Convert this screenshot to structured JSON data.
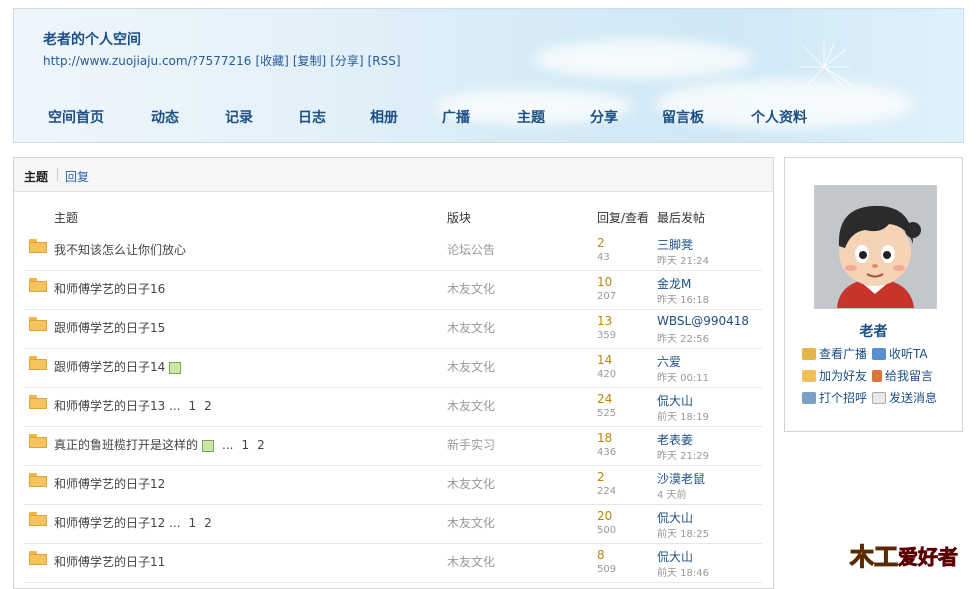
{
  "header": {
    "title": "老者的个人空间",
    "url": "http://www.zuojiaju.com/?7577216",
    "links": [
      "[收藏]",
      "[复制]",
      "[分享]",
      "[RSS]"
    ]
  },
  "nav": [
    "空间首页",
    "动态",
    "记录",
    "日志",
    "相册",
    "广播",
    "主题",
    "分享",
    "留言板",
    "个人资料"
  ],
  "tabs": {
    "topics": "主题",
    "replies": "回复"
  },
  "table": {
    "headers": {
      "topic": "主题",
      "forum": "版块",
      "stats": "回复/查看",
      "last": "最后发帖"
    },
    "rows": [
      {
        "title": "我不知该怎么让你们放心",
        "has_image": false,
        "pages": [],
        "forum": "论坛公告",
        "replies": "2",
        "views": "43",
        "last_user": "三脚凳",
        "last_time": "昨天 21:24"
      },
      {
        "title": "和师傅学艺的日子16",
        "has_image": false,
        "pages": [],
        "forum": "木友文化",
        "replies": "10",
        "views": "207",
        "last_user": "金龙M",
        "last_time": "昨天 16:18"
      },
      {
        "title": "跟师傅学艺的日子15",
        "has_image": false,
        "pages": [],
        "forum": "木友文化",
        "replies": "13",
        "views": "359",
        "last_user": "WBSL@990418",
        "last_time": "昨天 22:56"
      },
      {
        "title": "跟师傅学艺的日子14",
        "has_image": true,
        "pages": [],
        "forum": "木友文化",
        "replies": "14",
        "views": "420",
        "last_user": "六爱",
        "last_time": "昨天 00:11"
      },
      {
        "title": "和师傅学艺的日子13 ...",
        "has_image": false,
        "pages": [
          "1",
          "2"
        ],
        "forum": "木友文化",
        "replies": "24",
        "views": "525",
        "last_user": "侃大山",
        "last_time": "前天 18:19"
      },
      {
        "title": "真正的鲁班榄打开是这样的",
        "has_image": true,
        "pages": [
          "...",
          "1",
          "2"
        ],
        "forum": "新手实习",
        "replies": "18",
        "views": "436",
        "last_user": "老表姜",
        "last_time": "昨天 21:29"
      },
      {
        "title": "和师傅学艺的日子12",
        "has_image": false,
        "pages": [],
        "forum": "木友文化",
        "replies": "2",
        "views": "224",
        "last_user": "沙漠老鼠",
        "last_time": "4 天前"
      },
      {
        "title": "和师傅学艺的日子12 ...",
        "has_image": false,
        "pages": [
          "1",
          "2"
        ],
        "forum": "木友文化",
        "replies": "20",
        "views": "500",
        "last_user": "侃大山",
        "last_time": "前天 18:25"
      },
      {
        "title": "和师傅学艺的日子11",
        "has_image": false,
        "pages": [],
        "forum": "木友文化",
        "replies": "8",
        "views": "509",
        "last_user": "侃大山",
        "last_time": "前天 18:46"
      }
    ]
  },
  "profile": {
    "name": "老者",
    "actions": [
      "查看广播",
      "收听TA",
      "加为好友",
      "给我留言",
      "打个招呼",
      "发送消息"
    ]
  },
  "logo": {
    "text_main": "木工",
    "text_sub": "爱好者"
  }
}
